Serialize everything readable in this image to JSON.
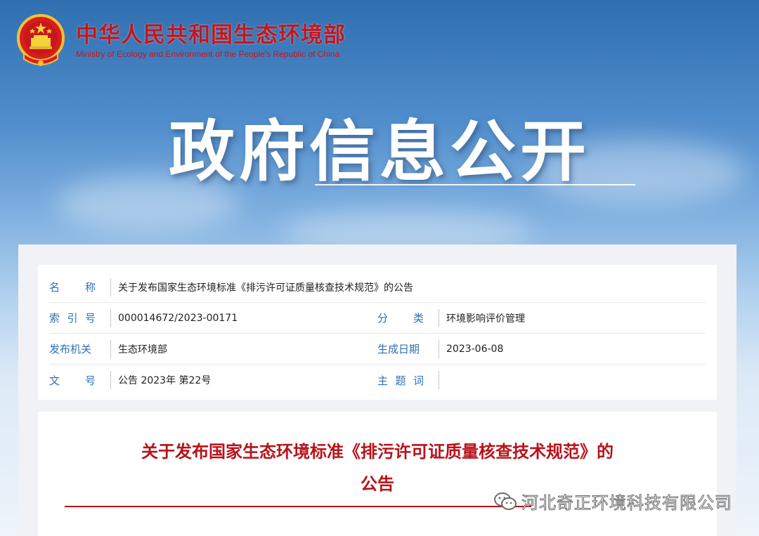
{
  "header": {
    "ministry_cn": "中华人民共和国生态环境部",
    "ministry_en": "Ministry of Ecology and Environment of the People's Republic of China",
    "emblem_icon": "national-emblem-icon"
  },
  "banner": {
    "title": "政府信息公开"
  },
  "info": {
    "name_label": [
      "名",
      "称"
    ],
    "name_value": "关于发布国家生态环境标准《排污许可证质量核查技术规范》的公告",
    "index_label": [
      "索",
      "引",
      "号"
    ],
    "index_value": "000014672/2023-00171",
    "category_label": [
      "分",
      "类"
    ],
    "category_value": "环境影响评价管理",
    "issuer_label": [
      "发布机关"
    ],
    "issuer_value": "生态环境部",
    "date_label": [
      "生成日期"
    ],
    "date_value": "2023-06-08",
    "docno_label": [
      "文",
      "号"
    ],
    "docno_value": "公告 2023年 第22号",
    "keywords_label": [
      "主",
      "题",
      "词"
    ],
    "keywords_value": ""
  },
  "document": {
    "title_line1": "关于发布国家生态环境标准《排污许可证质量核查技术规范》的",
    "title_line2": "公告"
  },
  "watermark": {
    "text": "河北奇正环境科技有限公司",
    "icon": "wechat-icon"
  },
  "colors": {
    "accent_red": "#c4161c",
    "label_blue": "#2e6fb5"
  }
}
